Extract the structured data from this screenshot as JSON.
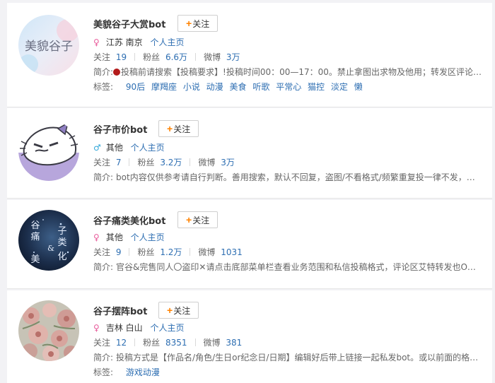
{
  "users": [
    {
      "name": "美貌谷子大赏bot",
      "follow_label": "关注",
      "gender": "♀",
      "location": "江苏 南京",
      "homepage": "个人主页",
      "stats": {
        "follow_label": "关注",
        "follow": "19",
        "fans_label": "粉丝",
        "fans": "6.6万",
        "weibo_label": "微博",
        "weibo": "3万"
      },
      "intro_label": "简介:",
      "intro": "投稿前请搜索【投稿要求】!投稿时间00：00—17：00。禁止拿图出求物及他用；转发区评论…",
      "tags_label": "标签:",
      "tags": [
        "90后",
        "摩羯座",
        "小说",
        "动漫",
        "美食",
        "听歌",
        "平常心",
        "猫控",
        "淡定",
        "懒"
      ],
      "avatar_text": "美貌谷子"
    },
    {
      "name": "谷子市价bot",
      "follow_label": "关注",
      "gender": "♂",
      "location": "其他",
      "homepage": "个人主页",
      "stats": {
        "follow_label": "关注",
        "follow": "7",
        "fans_label": "粉丝",
        "fans": "3.2万",
        "weibo_label": "微博",
        "weibo": "3万"
      },
      "intro_label": "简介:",
      "intro": "bot内容仅供参考请自行判断。善用搜索，默认不回复，盗图/不看格式/频繁重复投一律不发，…"
    },
    {
      "name": "谷子痛类美化bot",
      "follow_label": "关注",
      "gender": "♀",
      "location": "其他",
      "homepage": "个人主页",
      "stats": {
        "follow_label": "关注",
        "follow": "9",
        "fans_label": "粉丝",
        "fans": "1.2万",
        "weibo_label": "微博",
        "weibo": "1031"
      },
      "intro_label": "简介:",
      "intro": "官谷&完售同人〇盗印✕请点击底部菜单栏查看业务范围和私信投稿格式，评论区艾特转发也O…",
      "avatar_chars": [
        "谷",
        "痛",
        "子",
        "类",
        "&",
        "美",
        "化"
      ]
    },
    {
      "name": "谷子摆阵bot",
      "follow_label": "关注",
      "gender": "♀",
      "location": "吉林 白山",
      "homepage": "个人主页",
      "stats": {
        "follow_label": "关注",
        "follow": "12",
        "fans_label": "粉丝",
        "fans": "8351",
        "weibo_label": "微博",
        "weibo": "381"
      },
      "intro_label": "简介:",
      "intro": "投稿方式是【作品名/角色/生日or纪念日/日期】编辑好后带上链接一起私发bot。或以前面的格…",
      "tags_label": "标签:",
      "tags": [
        "游戏动漫"
      ]
    }
  ],
  "colors": {
    "link": "#2d6eb2",
    "accent": "#ff8200",
    "female": "#e85b9b",
    "male": "#31a7d9",
    "dot": "#b31b1b"
  }
}
